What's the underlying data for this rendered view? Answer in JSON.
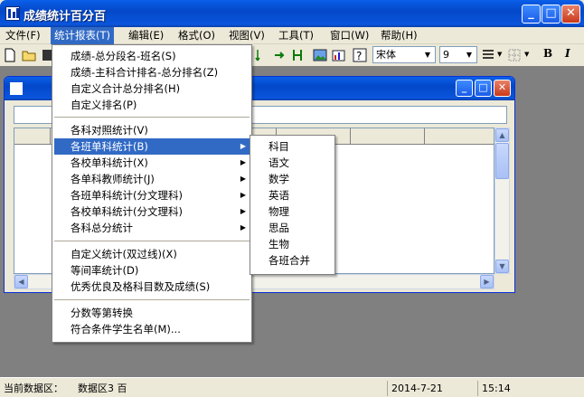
{
  "window": {
    "title": "成绩统计百分百"
  },
  "menubar": {
    "items": [
      {
        "label": "文件(F)"
      },
      {
        "label": "统计报表(T)"
      },
      {
        "label": "编辑(E)"
      },
      {
        "label": "格式(O)"
      },
      {
        "label": "视图(V)"
      },
      {
        "label": "工具(T)"
      },
      {
        "label": "窗口(W)"
      },
      {
        "label": "帮助(H)"
      }
    ]
  },
  "toolbar": {
    "font_name": "宋体",
    "font_size": "9",
    "bold": "B",
    "italic": "I"
  },
  "stats_menu": {
    "items": [
      {
        "label": "成绩-总分段名-班名(S)"
      },
      {
        "label": "成绩-主科合计排名-总分排名(Z)"
      },
      {
        "label": "自定义合计总分排名(H)"
      },
      {
        "label": "自定义排名(P)"
      },
      {
        "label": "各科对照统计(V)"
      },
      {
        "label": "各班单科统计(B)"
      },
      {
        "label": "各校单科统计(X)"
      },
      {
        "label": "各单科教师统计(J)"
      },
      {
        "label": "各班单科统计(分文理科)"
      },
      {
        "label": "各校单科统计(分文理科)"
      },
      {
        "label": "各科总分统计"
      },
      {
        "label": "自定义统计(双过线)(X)"
      },
      {
        "label": "等间率统计(D)"
      },
      {
        "label": "优秀优良及格科目数及成绩(S)"
      },
      {
        "label": "分数等第转换"
      },
      {
        "label": "符合条件学生名单(M)..."
      }
    ]
  },
  "submenu": {
    "items": [
      {
        "label": "科目"
      },
      {
        "label": "语文"
      },
      {
        "label": "数学"
      },
      {
        "label": "英语"
      },
      {
        "label": "物理"
      },
      {
        "label": "思品"
      },
      {
        "label": "生物"
      },
      {
        "label": "各班合并"
      }
    ]
  },
  "statusbar": {
    "data_area_label": "当前数据区：",
    "data_area_value": "数据区3 百",
    "date": "2014-7-21",
    "time": "15:14"
  },
  "colors": {
    "accent": "#316ac5",
    "titlebar": "#0a5fe8",
    "close": "#c9391a"
  }
}
